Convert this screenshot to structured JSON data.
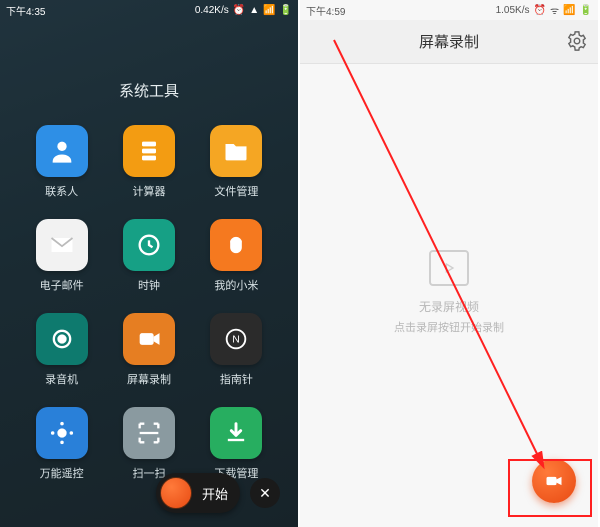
{
  "left": {
    "status": {
      "time": "下午4:35",
      "net": "0.42K/s"
    },
    "folder_title": "系统工具",
    "apps": [
      {
        "id": "contacts",
        "label": "联系人",
        "color": "c-blue"
      },
      {
        "id": "calculator",
        "label": "计算器",
        "color": "c-orange"
      },
      {
        "id": "files",
        "label": "文件管理",
        "color": "c-yellow"
      },
      {
        "id": "email",
        "label": "电子邮件",
        "color": "c-white"
      },
      {
        "id": "clock",
        "label": "时钟",
        "color": "c-teal"
      },
      {
        "id": "mymi",
        "label": "我的小米",
        "color": "c-orange2"
      },
      {
        "id": "recorder",
        "label": "录音机",
        "color": "c-dteal"
      },
      {
        "id": "screenrec",
        "label": "屏幕录制",
        "color": "c-sorange"
      },
      {
        "id": "compass",
        "label": "指南针",
        "color": "c-dark"
      },
      {
        "id": "remote",
        "label": "万能遥控",
        "color": "c-blue2"
      },
      {
        "id": "scan",
        "label": "扫一扫",
        "color": "c-gray"
      },
      {
        "id": "download",
        "label": "下载管理",
        "color": "c-green"
      }
    ],
    "record": {
      "start": "开始"
    }
  },
  "right": {
    "status": {
      "time": "下午4:59",
      "net": "1.05K/s"
    },
    "header_title": "屏幕录制",
    "empty_line1": "无录屏视频",
    "empty_line2": "点击录屏按钮开始录制"
  },
  "colors": {
    "accent": "#e84a12",
    "anno": "#ff2020"
  }
}
